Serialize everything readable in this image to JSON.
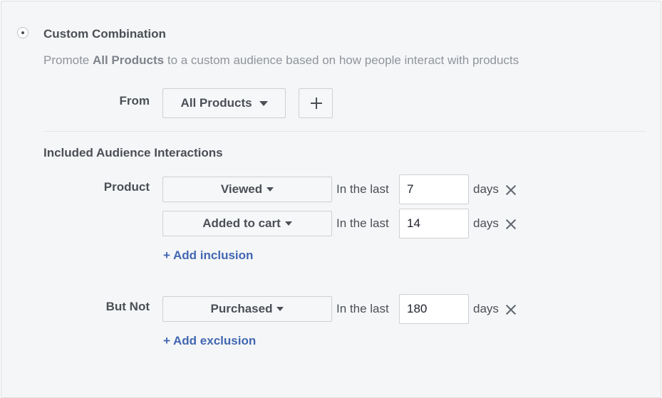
{
  "header": {
    "title": "Custom Combination",
    "description_prefix": "Promote",
    "description_bold": "All Products",
    "description_suffix": "to a custom audience based on how people interact with products"
  },
  "from": {
    "label": "From",
    "dropdown_value": "All Products",
    "add_icon": "plus-icon"
  },
  "included": {
    "heading": "Included Audience Interactions",
    "row_label": "Product",
    "rows": [
      {
        "event": "Viewed",
        "in_last": "In the last",
        "days_value": "7",
        "days": "days"
      },
      {
        "event": "Added to cart",
        "in_last": "In the last",
        "days_value": "14",
        "days": "days"
      }
    ],
    "add_link": "+ Add inclusion"
  },
  "excluded": {
    "row_label": "But Not",
    "rows": [
      {
        "event": "Purchased",
        "in_last": "In the last",
        "days_value": "180",
        "days": "days"
      }
    ],
    "add_link": "+ Add exclusion"
  },
  "colors": {
    "link": "#4267b2",
    "text": "#4b4f56",
    "muted": "#90949c",
    "panel": "#f5f6f7"
  }
}
